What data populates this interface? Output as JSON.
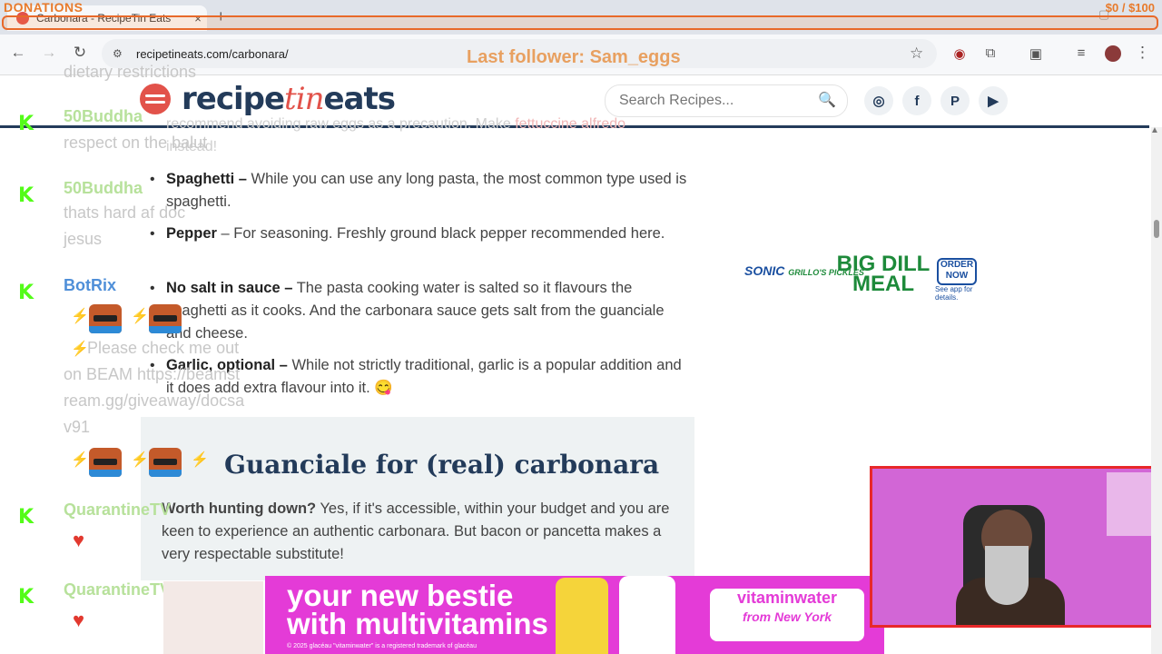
{
  "browser": {
    "tab_title": "Carbonara - RecipeTin Eats",
    "tab_close": "×",
    "new_tab": "+",
    "url": "recipetineats.com/carbonara/"
  },
  "overlay": {
    "donations_label": "DONATIONS",
    "donation_amount": "$0 / $100",
    "last_follower": "Last follower: Sam_eggs"
  },
  "site": {
    "logo_part1": "recipe",
    "logo_part2": "tin",
    "logo_part3": "eats",
    "search_placeholder": "Search Recipes..."
  },
  "chat": {
    "messages": [
      {
        "text": "dietary restrictions"
      },
      {
        "user": "50Buddha",
        "text": "respect on the balut"
      },
      {
        "user": "50Buddha",
        "text": "thats hard af doc jesus"
      },
      {
        "user": "BotRix",
        "text": "Please check me out on BEAM https://beamstream.gg/giveaway/docsav91"
      },
      {
        "user": "QuarantineTV"
      },
      {
        "user": "QuarantineTV"
      }
    ]
  },
  "article": {
    "faded_line": "recommend avoiding raw eggs as a precaution. Make",
    "faded_link": "fettuccine alfredo",
    "faded_line2": "instead!",
    "bullets": [
      {
        "term": "Spaghetti –",
        "text": "While you can use any long pasta, the most common type used is spaghetti."
      },
      {
        "term": "Pepper",
        "text": "– For seasoning. Freshly ground black pepper recommended here."
      },
      {
        "term": "No salt in sauce –",
        "text": "The pasta cooking water is salted so it flavours the spaghetti as it cooks. And the carbonara sauce gets salt from the guanciale and cheese."
      },
      {
        "term": "Garlic, optional –",
        "text": "While not strictly traditional, garlic is a popular addition and it does add extra flavour into it. 😋"
      }
    ],
    "section_title": "Guanciale for (real) carbonara",
    "section_term": "Worth hunting down?",
    "section_text": "Yes, if it's accessible, within your budget and you are keen to experience an authentic carbonara. But bacon or pancetta makes a very respectable substitute!"
  },
  "ads": {
    "sonic_brand": "SONIC",
    "sonic_partner": "GRILLO'S PICKLES",
    "sonic_headline": "BIG DILL MEAL",
    "sonic_cta": "ORDER NOW",
    "sonic_note": "See app for details.",
    "vw_headline_1": "your new bestie",
    "vw_headline_2": "with multivitamins",
    "vw_brand": "vitaminwater",
    "vw_sub": "from New York",
    "vw_legal": "© 2025 glacéau \"vitaminwater\" is a registered trademark of glacéau"
  }
}
